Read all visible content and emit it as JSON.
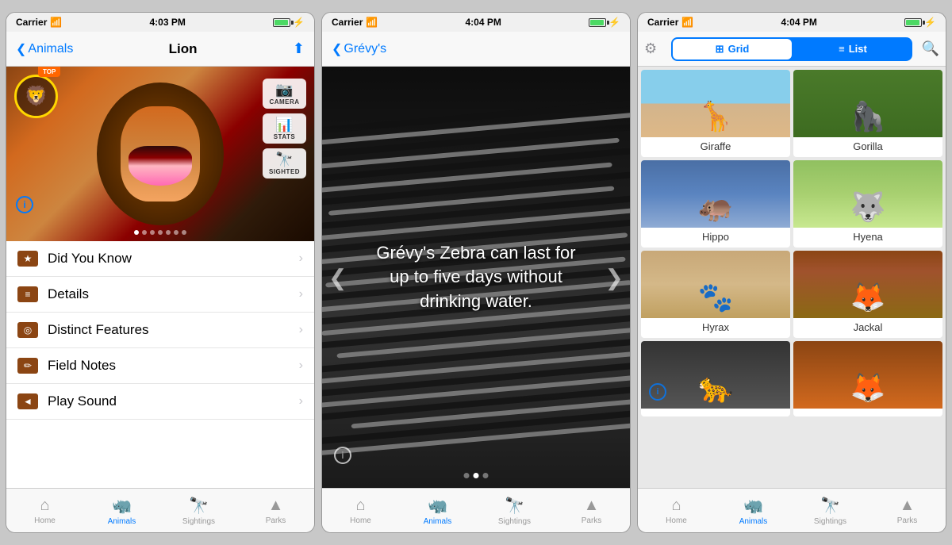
{
  "phone1": {
    "status": {
      "carrier": "Carrier",
      "wifi": "wifi",
      "time": "4:03 PM",
      "battery": "100"
    },
    "nav": {
      "back_label": "Animals",
      "title": "Lion"
    },
    "controls": {
      "camera_label": "CAMERA",
      "stats_label": "STATS",
      "sighted_label": "SIGHTED"
    },
    "badge_text": "TOP",
    "menu_items": [
      {
        "id": "did-you-know",
        "label": "Did You Know",
        "icon": "★"
      },
      {
        "id": "details",
        "label": "Details",
        "icon": "≡"
      },
      {
        "id": "distinct-features",
        "label": "Distinct Features",
        "icon": "◎"
      },
      {
        "id": "field-notes",
        "label": "Field Notes",
        "icon": "✏"
      },
      {
        "id": "play-sound",
        "label": "Play Sound",
        "icon": "◄"
      }
    ],
    "tabs": [
      {
        "id": "home",
        "label": "Home",
        "icon": "⌂",
        "active": false
      },
      {
        "id": "animals",
        "label": "Animals",
        "icon": "🦏",
        "active": true
      },
      {
        "id": "sightings",
        "label": "Sightings",
        "icon": "🔭",
        "active": false
      },
      {
        "id": "parks",
        "label": "Parks",
        "icon": "▲",
        "active": false
      }
    ]
  },
  "phone2": {
    "status": {
      "carrier": "Carrier",
      "wifi": "wifi",
      "time": "4:04 PM",
      "battery": "100"
    },
    "nav": {
      "back_label": "Grévy's"
    },
    "fact_text": "Grévy's Zebra can last for up to five days without drinking water.",
    "tabs": [
      {
        "id": "home",
        "label": "Home",
        "icon": "⌂",
        "active": false
      },
      {
        "id": "animals",
        "label": "Animals",
        "icon": "🦏",
        "active": true
      },
      {
        "id": "sightings",
        "label": "Sightings",
        "icon": "🔭",
        "active": false
      },
      {
        "id": "parks",
        "label": "Parks",
        "icon": "▲",
        "active": false
      }
    ]
  },
  "phone3": {
    "status": {
      "carrier": "Carrier",
      "wifi": "wifi",
      "time": "4:04 PM",
      "battery": "100"
    },
    "nav": {
      "grid_label": "Grid",
      "list_label": "List"
    },
    "animals": [
      {
        "id": "giraffe",
        "name": "Giraffe",
        "thumb_class": "thumb-giraffe"
      },
      {
        "id": "gorilla",
        "name": "Gorilla",
        "thumb_class": "thumb-gorilla"
      },
      {
        "id": "hippo",
        "name": "Hippo",
        "thumb_class": "thumb-hippo"
      },
      {
        "id": "hyena",
        "name": "Hyena",
        "thumb_class": "thumb-hyena"
      },
      {
        "id": "hyrax",
        "name": "Hyrax",
        "thumb_class": "thumb-hyrax"
      },
      {
        "id": "jackal",
        "name": "Jackal",
        "thumb_class": "thumb-jackal"
      },
      {
        "id": "row7a",
        "name": "",
        "thumb_class": "thumb-row7a"
      },
      {
        "id": "row7b",
        "name": "",
        "thumb_class": "thumb-row7b"
      }
    ],
    "tabs": [
      {
        "id": "home",
        "label": "Home",
        "icon": "⌂",
        "active": false
      },
      {
        "id": "animals",
        "label": "Animals",
        "icon": "🦏",
        "active": true
      },
      {
        "id": "sightings",
        "label": "Sightings",
        "icon": "🔭",
        "active": false
      },
      {
        "id": "parks",
        "label": "Parks",
        "icon": "▲",
        "active": false
      }
    ]
  }
}
